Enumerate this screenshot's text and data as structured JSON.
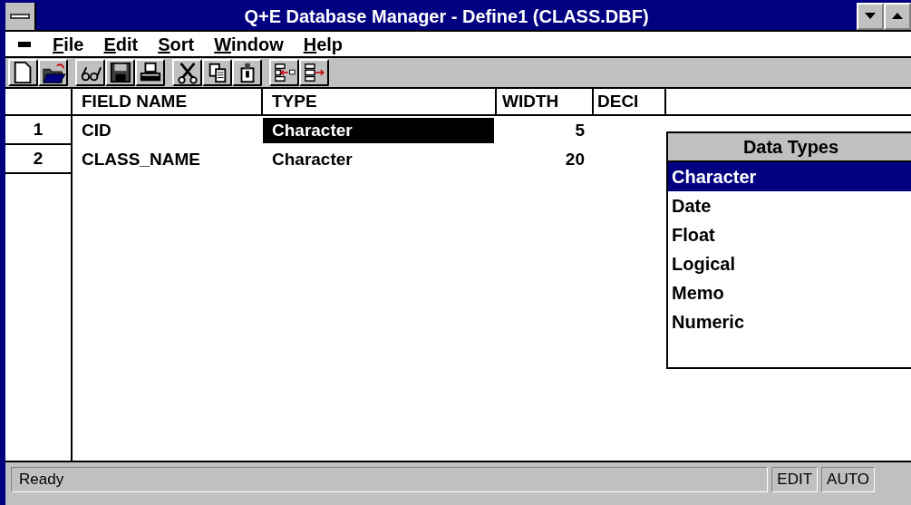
{
  "window": {
    "title": "Q+E Database Manager - Define1 (CLASS.DBF)"
  },
  "menu": [
    "File",
    "Edit",
    "Sort",
    "Window",
    "Help"
  ],
  "table": {
    "columns": [
      "FIELD NAME",
      "TYPE",
      "WIDTH",
      "DECI"
    ],
    "rows": [
      {
        "number": "1",
        "cells": [
          {
            "text": "CID",
            "selected": false
          },
          {
            "text": "Character",
            "selected": true
          },
          {
            "text": "5",
            "selected": false
          }
        ]
      },
      {
        "number": "2",
        "cells": [
          {
            "text": "CLASS_NAME",
            "selected": false
          },
          {
            "text": "Character",
            "selected": false
          },
          {
            "text": "20",
            "selected": false
          }
        ]
      }
    ]
  },
  "data_types": {
    "title": "Data Types",
    "items": [
      {
        "label": "Character",
        "selected": true
      },
      {
        "label": "Date",
        "selected": false
      },
      {
        "label": "Float",
        "selected": false
      },
      {
        "label": "Logical",
        "selected": false
      },
      {
        "label": "Memo",
        "selected": false
      },
      {
        "label": "Numeric",
        "selected": false
      }
    ]
  },
  "status_bar": {
    "message": "Ready",
    "indicators": [
      "EDIT",
      "AUTO"
    ]
  }
}
